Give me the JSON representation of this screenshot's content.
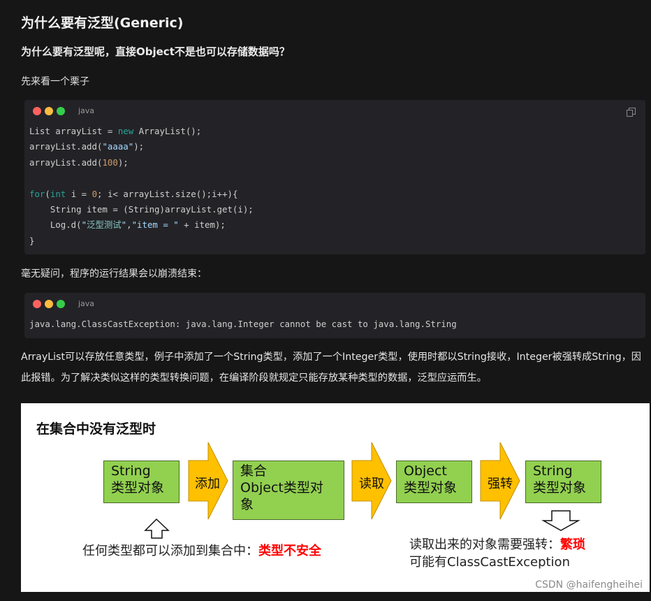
{
  "heading": "为什么要有泛型(Generic)",
  "subheading": "为什么要有泛型呢，直接Object不是也可以存储数据吗？",
  "intro": "先来看一个栗子",
  "code1": {
    "lang": "java",
    "icons": [
      "window-controls",
      "copy-icon"
    ]
  },
  "result_text": "毫无疑问，程序的运行结果会以崩溃结束：",
  "code2": {
    "lang": "java",
    "line": "java.lang.ClassCastException: java.lang.Integer cannot be cast to java.lang.String"
  },
  "explanation": "ArrayList可以存放任意类型，例子中添加了一个String类型，添加了一个Integer类型，使用时都以String接收，Integer被强转成String，因此报错。为了解决类似这样的类型转换问题，在编译阶段就规定只能存放某种类型的数据，泛型应运而生。",
  "figure": {
    "title": "在集合中没有泛型时",
    "boxes": [
      {
        "line1": "String",
        "line2": "类型对象"
      },
      {
        "line1": "集合",
        "line2": "Object类型对",
        "line3": "象"
      },
      {
        "line1": "Object",
        "line2": "类型对象"
      },
      {
        "line1": "String",
        "line2": "类型对象"
      }
    ],
    "arrows": [
      "添加",
      "读取",
      "强转"
    ],
    "caption_left": {
      "text": "任何类型都可以添加到集合中：",
      "highlight": "类型不安全"
    },
    "caption_right": {
      "line1": "读取出来的对象需要强转：",
      "highlight": "繁琐",
      "line2": "可能有ClassCastException"
    },
    "colors": {
      "box": "#92d050",
      "arrow": "#ffc000",
      "highlight": "#ff0000"
    }
  },
  "watermark": "CSDN @haifengheihei"
}
